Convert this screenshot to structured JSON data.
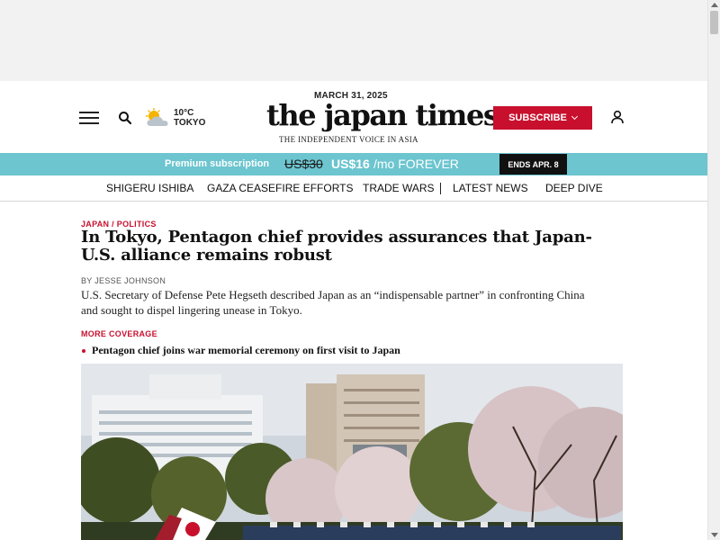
{
  "header": {
    "date": "MARCH 31, 2025",
    "logo_text": "the japan times",
    "tagline": "THE INDEPENDENT VOICE IN ASIA",
    "weather": {
      "temp": "10°C",
      "city": "TOKYO",
      "icon": "partly-cloudy-icon"
    },
    "subscribe_label": "SUBSCRIBE",
    "icons": [
      "hamburger-menu-icon",
      "search-icon",
      "user-icon"
    ]
  },
  "promo": {
    "label": "Premium subscription",
    "old_price": "US$30",
    "new_price": "US$16",
    "suffix": "/mo FOREVER",
    "ends": "ENDS APR. 8"
  },
  "topics": [
    "SHIGERU ISHIBA",
    "GAZA CEASEFIRE EFFORTS",
    "TRADE WARS",
    "LATEST NEWS",
    "DEEP DIVE"
  ],
  "article": {
    "category": [
      "JAPAN",
      "POLITICS"
    ],
    "category_separator": "/",
    "headline": "In Tokyo, Pentagon chief provides assurances that Japan-U.S. alliance remains robust",
    "byline": "BY JESSE JOHNSON",
    "summary": "U.S. Secretary of Defense Pete Hegseth described Japan as an “indispensable partner” in confronting China and sought to dispel lingering unease in Tokyo.",
    "more_coverage_label": "MORE COVERAGE",
    "more_coverage": [
      "Pentagon chief joins war memorial ceremony on first visit to Japan"
    ]
  },
  "colors": {
    "brand_red": "#c8102e",
    "promo_teal": "#6cc5cf",
    "ends_badge": "#111111"
  }
}
